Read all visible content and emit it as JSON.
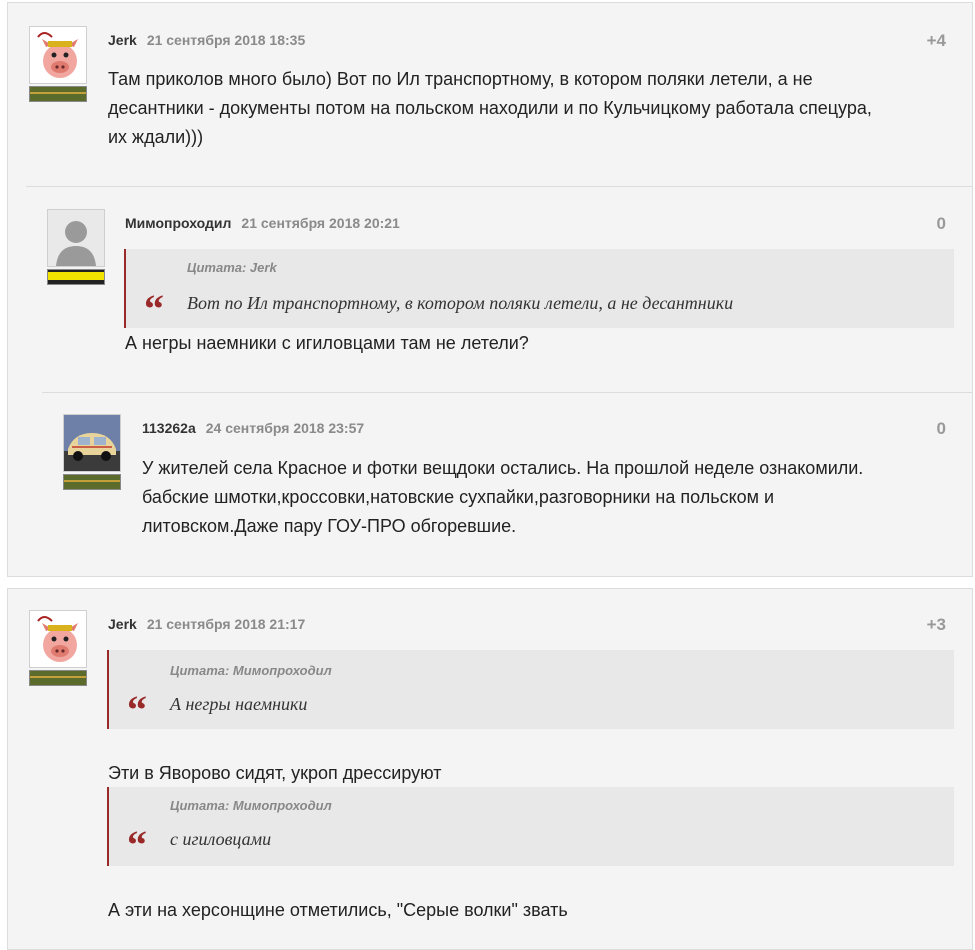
{
  "comments": [
    {
      "author": "Jerk",
      "date": "21 сентября 2018 18:35",
      "score": "+4",
      "lines": [
        "Там приколов много было) Вот по Ил транспортному, в котором поляки летели, а не",
        "десантники - документы потом на польском находили и по Кульчицкому работала спецура,",
        "их ждали)))"
      ]
    },
    {
      "author": "Мимопроходил",
      "date": "21 сентября 2018 20:21",
      "score": "0",
      "quote_label": "Цитата: Jerk",
      "quote_text": "Вот по Ил транспортному, в котором поляки летели, а не десантники",
      "text": "А негры наемники с игиловцами там не летели?"
    },
    {
      "author": "113262а",
      "date": "24 сентября 2018 23:57",
      "score": "0",
      "lines": [
        "У жителей села Красное и фотки вещдоки остались. На прошлой неделе ознакомили.",
        "бабские шмотки,кроссовки,натовские сухпайки,разговорники на польском и",
        "литовском.Даже пару ГОУ-ПРО обгоревшие."
      ]
    },
    {
      "author": "Jerk",
      "date": "21 сентября 2018 21:17",
      "score": "+3",
      "quote1_label": "Цитата: Мимопроходил",
      "quote1_text": "А негры наемники",
      "text1": "Эти в Яворово сидят, укроп дрессируют",
      "quote2_label": "Цитата: Мимопроходил",
      "quote2_text": "с игиловцами",
      "text2": "А эти на херсонщине отметились, \"Серые волки\" звать"
    }
  ],
  "quote_mark": "“",
  "colors": {
    "accent": "#9a2a2a",
    "background": "#f4f4f4",
    "quote_bg": "#e8e8e8"
  }
}
